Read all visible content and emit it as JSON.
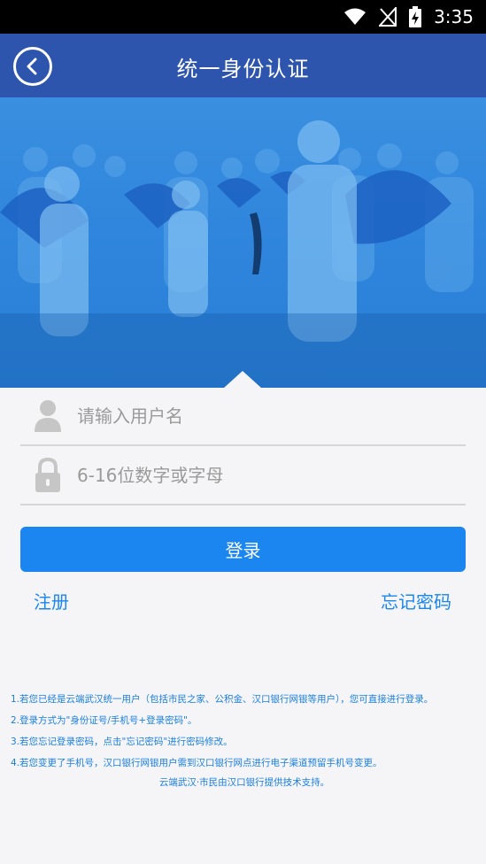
{
  "status_bar": {
    "time": "3:35"
  },
  "header": {
    "title": "统一身份认证"
  },
  "form": {
    "username_placeholder": "请输入用户名",
    "password_placeholder": "6-16位数字或字母",
    "login_label": "登录",
    "register_label": "注册",
    "forgot_label": "忘记密码"
  },
  "notes": {
    "items": [
      "1.若您已经是云端武汉统一用户（包括市民之家、公积金、汉口银行网银等用户），您可直接进行登录。",
      "2.登录方式为\"身份证号/手机号+登录密码\"。",
      "3.若您忘记登录密码，点击\"忘记密码\"进行密码修改。",
      "4.若您变更了手机号，汉口银行网银用户需到汉口银行网点进行电子渠道预留手机号变更。"
    ],
    "footer": "云端武汉·市民由汉口银行提供技术支持。"
  },
  "colors": {
    "header": "#2e55ad",
    "accent": "#1b86f0"
  }
}
